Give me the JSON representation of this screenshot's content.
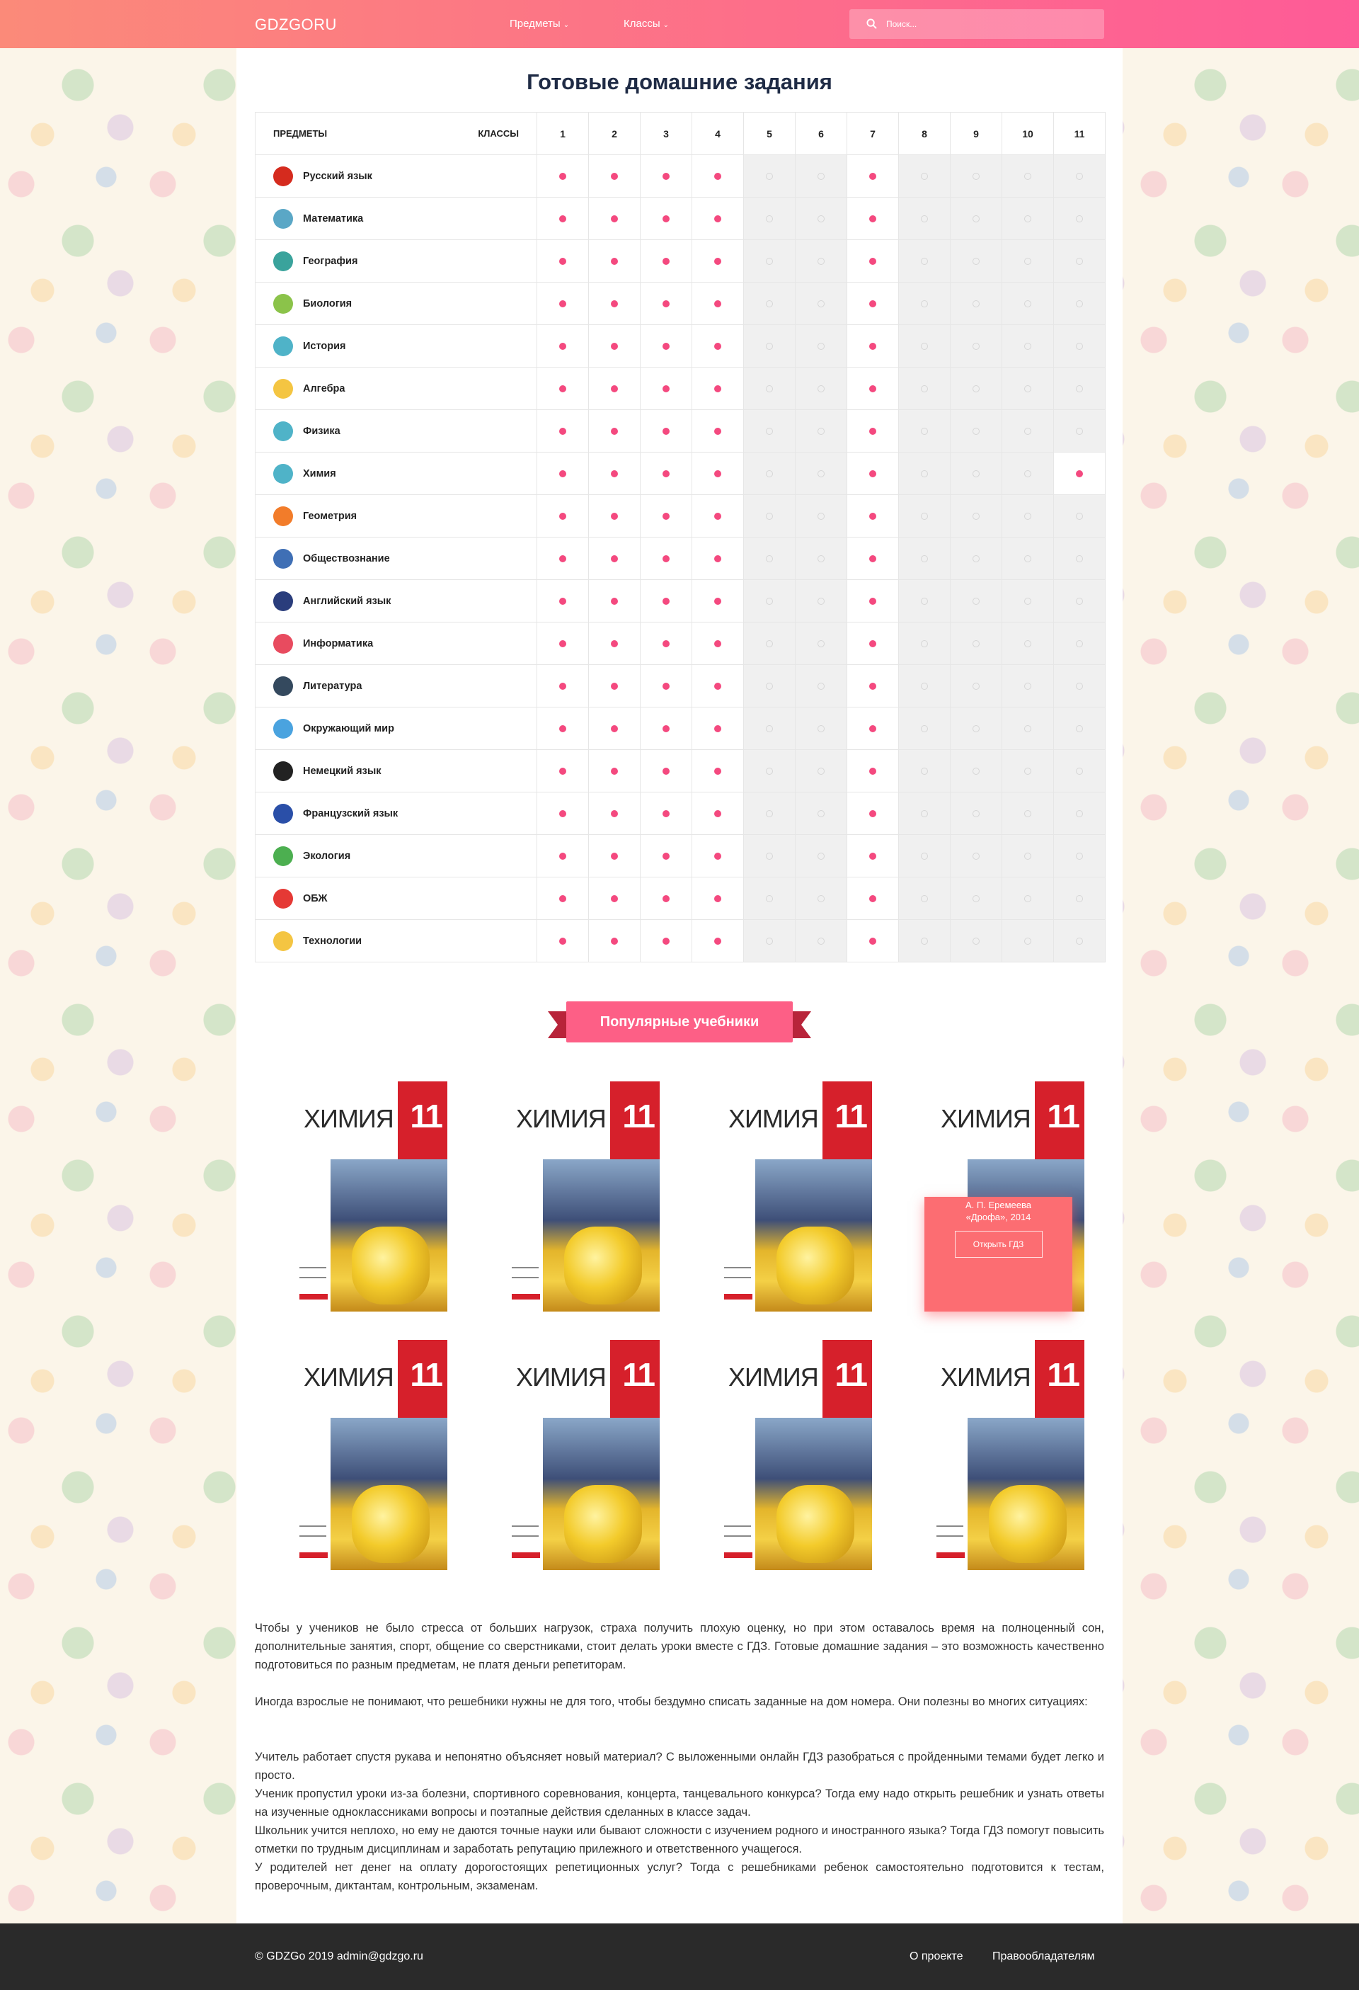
{
  "header": {
    "logo": "GDZGORU",
    "nav": [
      {
        "label": "Предметы"
      },
      {
        "label": "Классы"
      }
    ],
    "search_placeholder": "Поиск..."
  },
  "page_title": "Готовые домашние задания",
  "table": {
    "head_subjects": "ПРЕДМЕТЫ",
    "head_classes": "КЛАССЫ",
    "grades": [
      "1",
      "2",
      "3",
      "4",
      "5",
      "6",
      "7",
      "8",
      "9",
      "10",
      "11"
    ],
    "available_color": "#f4497f",
    "gray_columns": [
      5,
      6,
      8,
      9,
      10,
      11
    ],
    "rows": [
      {
        "subject": "Русский язык",
        "icon": "russia-flag-icon",
        "color": "#d52b1e",
        "highlight_grade": null
      },
      {
        "subject": "Математика",
        "icon": "calculator-icon",
        "color": "#5aa7c6",
        "highlight_grade": null
      },
      {
        "subject": "География",
        "icon": "globe-icon",
        "color": "#3aa39c",
        "highlight_grade": null
      },
      {
        "subject": "Биология",
        "icon": "cell-icon",
        "color": "#8bc34a",
        "highlight_grade": null
      },
      {
        "subject": "История",
        "icon": "book-icon",
        "color": "#4fb3c8",
        "highlight_grade": null
      },
      {
        "subject": "Алгебра",
        "icon": "notepad-icon",
        "color": "#f4c542",
        "highlight_grade": null
      },
      {
        "subject": "Физика",
        "icon": "atom-icon",
        "color": "#4fb3c8",
        "highlight_grade": null
      },
      {
        "subject": "Химия",
        "icon": "flask-icon",
        "color": "#4fb3c8",
        "highlight_grade": "11"
      },
      {
        "subject": "Геометрия",
        "icon": "triangle-icon",
        "color": "#f27c2a",
        "highlight_grade": null
      },
      {
        "subject": "Обществознание",
        "icon": "people-icon",
        "color": "#3f6fb5",
        "highlight_grade": null
      },
      {
        "subject": "Английский язык",
        "icon": "uk-flag-icon",
        "color": "#2a3d7c",
        "highlight_grade": null
      },
      {
        "subject": "Информатика",
        "icon": "computer-icon",
        "color": "#e84b5f",
        "highlight_grade": null
      },
      {
        "subject": "Литература",
        "icon": "books-icon",
        "color": "#34495e",
        "highlight_grade": null
      },
      {
        "subject": "Окружающий мир",
        "icon": "apple-icon",
        "color": "#4aa3df",
        "highlight_grade": null
      },
      {
        "subject": "Немецкий язык",
        "icon": "germany-flag-icon",
        "color": "#222222",
        "highlight_grade": null
      },
      {
        "subject": "Французский язык",
        "icon": "france-flag-icon",
        "color": "#2a4fa8",
        "highlight_grade": null
      },
      {
        "subject": "Экология",
        "icon": "recycle-icon",
        "color": "#4caf50",
        "highlight_grade": null
      },
      {
        "subject": "ОБЖ",
        "icon": "helmet-icon",
        "color": "#e53935",
        "highlight_grade": null
      },
      {
        "subject": "Технологии",
        "icon": "lightbulb-icon",
        "color": "#f4c542",
        "highlight_grade": null
      }
    ]
  },
  "popular": {
    "title": "Популярные учебники",
    "book": {
      "title": "ХИМИЯ",
      "grade": "11"
    },
    "overlay": {
      "author": "А. П. Еремеева",
      "publisher": "«Дрофа», 2014",
      "button": "Открыть ГДЗ"
    }
  },
  "text": {
    "p1": "Чтобы у учеников не было стресса от больших нагрузок, страха получить плохую оценку, но при этом оставалось время на полноценный сон, дополнительные занятия, спорт, общение со сверстниками, стоит делать уроки вместе с ГДЗ. Готовые домашние задания – это возможность качественно подготовиться по разным предметам, не платя деньги репетиторам.",
    "p2": "Иногда взрослые не понимают, что решебники нужны не для того, чтобы бездумно списать заданные на дом номера. Они полезны во многих ситуациях:",
    "l1": "Учитель работает спустя рукава и непонятно объясняет новый материал? С выложенными онлайн ГДЗ разобраться с пройденными темами будет легко и просто.",
    "l2": "Ученик пропустил уроки из-за болезни, спортивного соревнования, концерта, танцевального конкурса? Тогда ему надо открыть решебник и узнать ответы на изученные одноклассниками вопросы и поэтапные действия сделанных в классе задач.",
    "l3": "Школьник учится неплохо, но ему не даются точные науки или бывают сложности с изучением родного и иностранного языка? Тогда ГДЗ помогут повысить отметки по трудным дисциплинам и заработать репутацию прилежного и ответственного учащегося.",
    "l4": "У родителей нет денег на оплату дорогостоящих репетиционных услуг? Тогда с решебниками ребенок самостоятельно подготовится к тестам, проверочным, диктантам, контрольным, экзаменам."
  },
  "footer": {
    "copyright": "© GDZGo 2019 admin@gdzgo.ru",
    "links": [
      "О проекте",
      "Правообладателям"
    ]
  }
}
